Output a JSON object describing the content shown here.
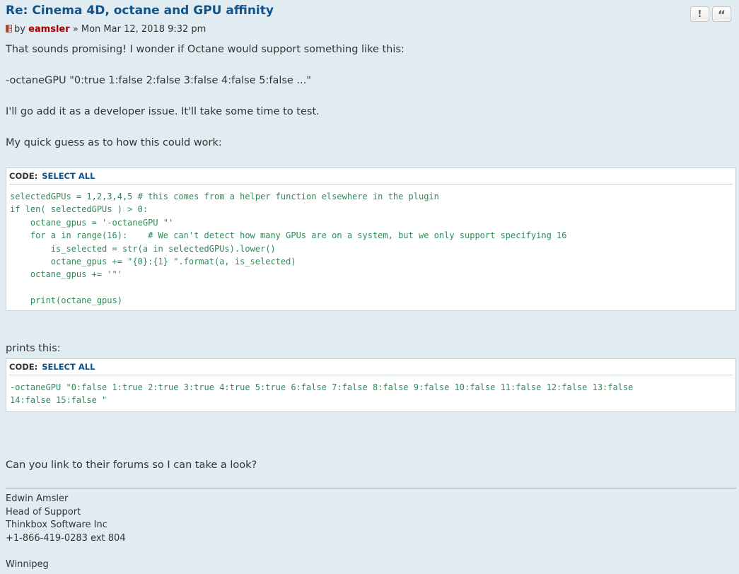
{
  "post": {
    "title": "Re: Cinema 4D, octane and GPU affinity",
    "by_label": "by",
    "author": "eamsler",
    "date": "» Mon Mar 12, 2018 9:32 pm",
    "report_button": "!",
    "quote_button": "“"
  },
  "body": {
    "p1": "That sounds promising! I wonder if Octane would support something like this:",
    "p2": "-octaneGPU \"0:true 1:false 2:false 3:false 4:false 5:false ...\"",
    "p3": "I'll go add it as a developer issue. It'll take some time to test.",
    "p4": "My quick guess as to how this could work:",
    "p5": "prints this:",
    "p6": "Can you link to their forums so I can take a look?"
  },
  "code1": {
    "label": "CODE:",
    "select_all": "SELECT ALL",
    "text": "selectedGPUs = 1,2,3,4,5 # this comes from a helper function elsewhere in the plugin\nif len( selectedGPUs ) > 0:\n    octane_gpus = '-octaneGPU \"'\n    for a in range(16):    # We can't detect how many GPUs are on a system, but we only support specifying 16\n        is_selected = str(a in selectedGPUs).lower()\n        octane_gpus += \"{0}:{1} \".format(a, is_selected)\n    octane_gpus += '\"'\n\n    print(octane_gpus)"
  },
  "code2": {
    "label": "CODE:",
    "select_all": "SELECT ALL",
    "text": "-octaneGPU \"0:false 1:true 2:true 3:true 4:true 5:true 6:false 7:false 8:false 9:false 10:false 11:false 12:false 13:false\n14:false 15:false \""
  },
  "signature": {
    "text": "Edwin Amsler\nHead of Support\nThinkbox Software Inc\n+1-866-419-0283 ext 804\n\nWinnipeg"
  },
  "colors": {
    "background": "#e1ebf2",
    "title": "#105289",
    "author": "#aa0000",
    "code": "#2e8b57"
  }
}
